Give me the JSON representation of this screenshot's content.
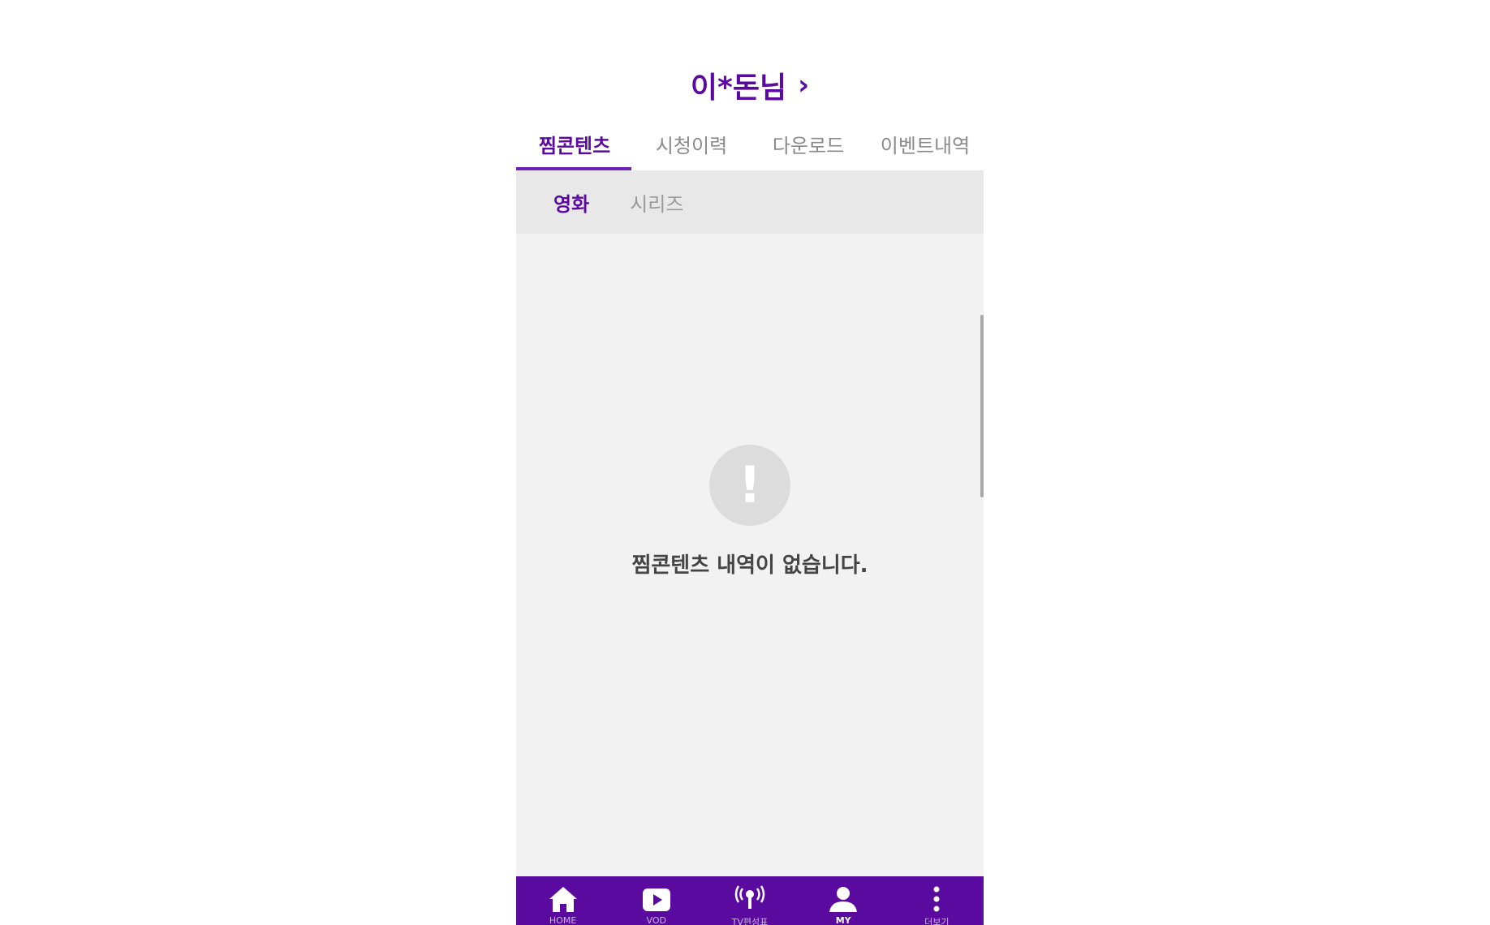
{
  "header": {
    "user_name": "이*돈님",
    "chevron": "›"
  },
  "tabs": [
    {
      "label": "찜콘텐츠",
      "active": true
    },
    {
      "label": "시청이력",
      "active": false
    },
    {
      "label": "다운로드",
      "active": false
    },
    {
      "label": "이벤트내역",
      "active": false
    }
  ],
  "subtabs": [
    {
      "label": "영화",
      "active": true
    },
    {
      "label": "시리즈",
      "active": false
    }
  ],
  "empty_state": {
    "icon": "exclamation-icon",
    "symbol": "!",
    "message": "찜콘텐츠 내역이 없습니다."
  },
  "bottom_nav": [
    {
      "icon": "home-icon",
      "label": "HOME",
      "active": false
    },
    {
      "icon": "vod-icon",
      "label": "VOD",
      "active": false
    },
    {
      "icon": "broadcast-icon",
      "label": "TV편성표",
      "active": false
    },
    {
      "icon": "person-icon",
      "label": "MY",
      "active": true
    },
    {
      "icon": "more-vertical-icon",
      "label": "더보기",
      "active": false
    }
  ],
  "colors": {
    "brand_purple": "#5a0a9e",
    "tab_underline": "#6a22b8",
    "content_bg": "#f2f2f2",
    "subtab_bg": "#e8e8e8"
  }
}
